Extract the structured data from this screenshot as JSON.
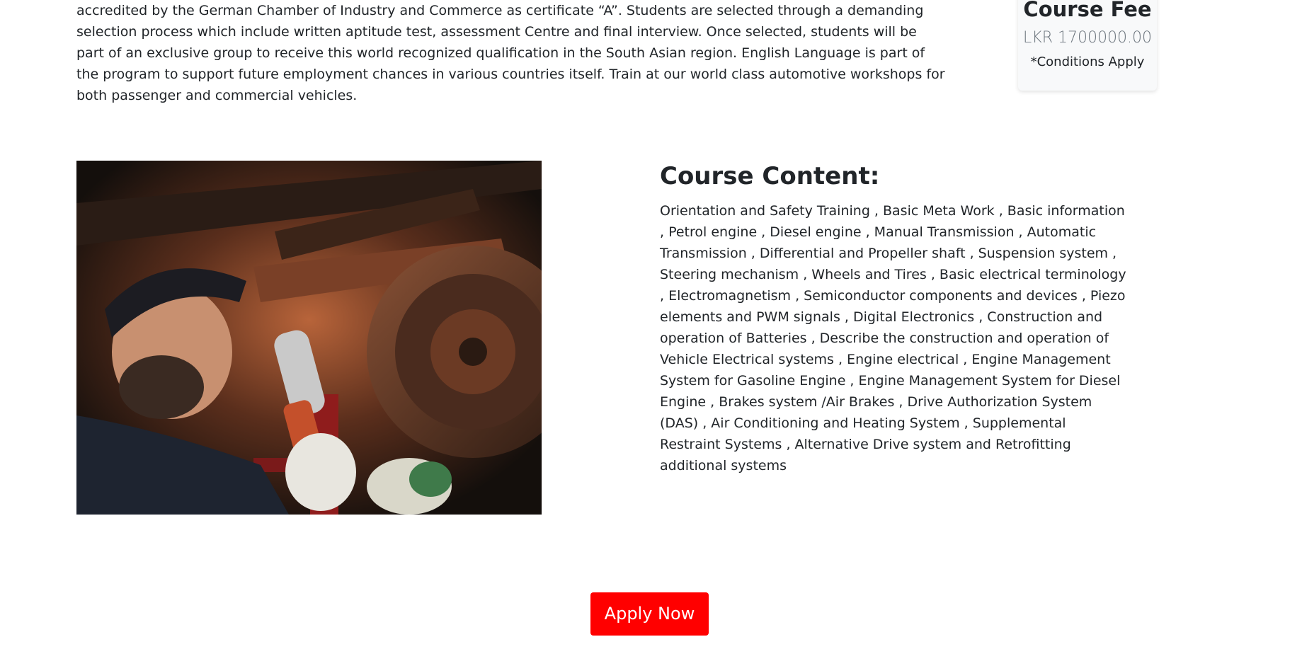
{
  "intro": {
    "text": "accredited by the German Chamber of Industry and Commerce as certificate “A”. Students are selected through a demanding selection process which include written aptitude test, assessment Centre and final interview. Once selected, students will be part of an exclusive group to receive this world recognized qualification in the South Asian region. English Language is part of the program to support future employment chances in various countries itself. Train at our world class automotive workshops for both passenger and commercial vehicles."
  },
  "fee": {
    "title": "Course Fee",
    "amount": "LKR 1700000.00",
    "note": "*Conditions Apply"
  },
  "content": {
    "title": "Course Content:",
    "text": "Orientation and Safety Training , Basic Meta Work , Basic information , Petrol engine , Diesel engine , Manual Transmission , Automatic Transmission , Differential and Propeller shaft , Suspension system , Steering mechanism , Wheels and Tires , Basic electrical terminology , Electromagnetism , Semiconductor components and devices , Piezo elements and PWM signals , Digital Electronics , Construction and operation of Batteries , Describe the construction and operation of Vehicle Electrical systems , Engine electrical , Engine Management System for Gasoline Engine , Engine Management System for Diesel Engine , Brakes system /Air Brakes , Drive Authorization System (DAS) , Air Conditioning and Heating System , Supplemental Restraint Systems , Alternative Drive system and Retrofitting additional systems"
  },
  "apply": {
    "label": "Apply Now"
  },
  "colors": {
    "accent": "#ff0000",
    "text": "#212529",
    "muted": "#6c757d",
    "card_bg": "#f8f9fa"
  }
}
